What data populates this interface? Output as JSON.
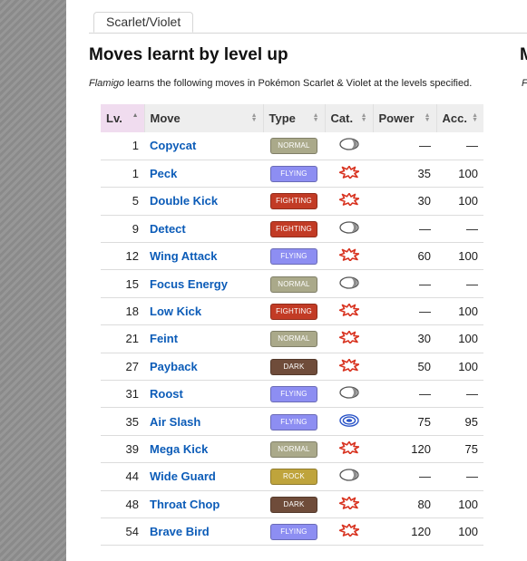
{
  "tabs": [
    {
      "label": "Scarlet/Violet"
    }
  ],
  "heading": "Moves learnt by level up",
  "heading_next": "M",
  "intro": {
    "pokemon": "Flamigo",
    "text": " learns the following moves in Pokémon Scarlet & Violet at the levels specified.",
    "next": "Fl"
  },
  "table": {
    "headers": [
      "Lv.",
      "Move",
      "Type",
      "Cat.",
      "Power",
      "Acc."
    ],
    "rows": [
      {
        "lv": "1",
        "move": "Copycat",
        "type": "Normal",
        "cat": "status",
        "power": "—",
        "acc": "—"
      },
      {
        "lv": "1",
        "move": "Peck",
        "type": "Flying",
        "cat": "physical",
        "power": "35",
        "acc": "100"
      },
      {
        "lv": "5",
        "move": "Double Kick",
        "type": "Fighting",
        "cat": "physical",
        "power": "30",
        "acc": "100"
      },
      {
        "lv": "9",
        "move": "Detect",
        "type": "Fighting",
        "cat": "status",
        "power": "—",
        "acc": "—"
      },
      {
        "lv": "12",
        "move": "Wing Attack",
        "type": "Flying",
        "cat": "physical",
        "power": "60",
        "acc": "100"
      },
      {
        "lv": "15",
        "move": "Focus Energy",
        "type": "Normal",
        "cat": "status",
        "power": "—",
        "acc": "—"
      },
      {
        "lv": "18",
        "move": "Low Kick",
        "type": "Fighting",
        "cat": "physical",
        "power": "—",
        "acc": "100"
      },
      {
        "lv": "21",
        "move": "Feint",
        "type": "Normal",
        "cat": "physical",
        "power": "30",
        "acc": "100"
      },
      {
        "lv": "27",
        "move": "Payback",
        "type": "Dark",
        "cat": "physical",
        "power": "50",
        "acc": "100"
      },
      {
        "lv": "31",
        "move": "Roost",
        "type": "Flying",
        "cat": "status",
        "power": "—",
        "acc": "—"
      },
      {
        "lv": "35",
        "move": "Air Slash",
        "type": "Flying",
        "cat": "special",
        "power": "75",
        "acc": "95"
      },
      {
        "lv": "39",
        "move": "Mega Kick",
        "type": "Normal",
        "cat": "physical",
        "power": "120",
        "acc": "75"
      },
      {
        "lv": "44",
        "move": "Wide Guard",
        "type": "Rock",
        "cat": "status",
        "power": "—",
        "acc": "—"
      },
      {
        "lv": "48",
        "move": "Throat Chop",
        "type": "Dark",
        "cat": "physical",
        "power": "80",
        "acc": "100"
      },
      {
        "lv": "54",
        "move": "Brave Bird",
        "type": "Flying",
        "cat": "physical",
        "power": "120",
        "acc": "100"
      }
    ]
  },
  "type_colors": {
    "Normal": "#aaa98a",
    "Flying": "#8d8ef2",
    "Fighting": "#c23b25",
    "Dark": "#6f4c3a",
    "Rock": "#bfa43c"
  },
  "category_icons": {
    "physical": "physical-move-icon",
    "special": "special-move-icon",
    "status": "status-move-icon"
  },
  "colors": {
    "link": "#0c5cb8",
    "active_header": "#f0dcef"
  }
}
